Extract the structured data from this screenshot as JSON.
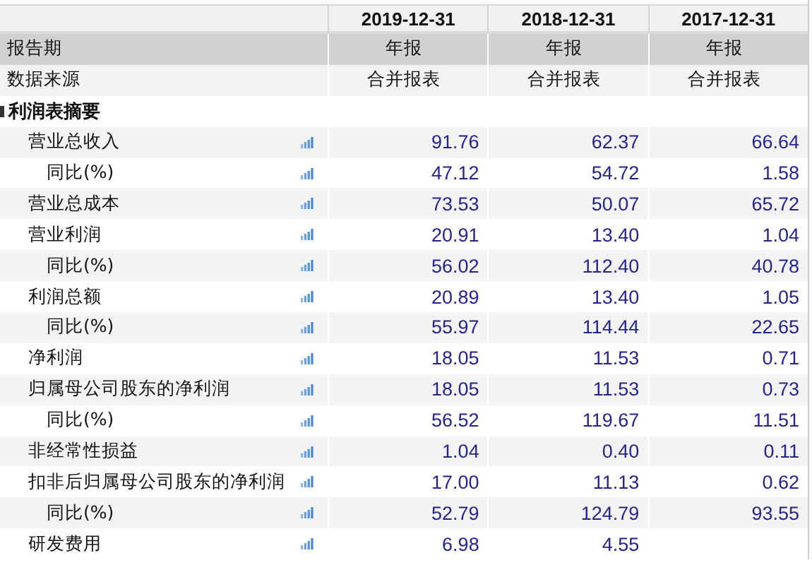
{
  "columns": [
    "2019-12-31",
    "2018-12-31",
    "2017-12-31"
  ],
  "meta_rows": [
    {
      "label": "报告期",
      "kind": "period",
      "values": [
        "年报",
        "年报",
        "年报"
      ]
    },
    {
      "label": "数据来源",
      "kind": "source",
      "values": [
        "合并报表",
        "合并报表",
        "合并报表"
      ]
    }
  ],
  "section": {
    "title": "利润表摘要",
    "expanded": true,
    "rows": [
      {
        "label": "营业总收入",
        "values": [
          "91.76",
          "62.37",
          "66.64"
        ],
        "children": [
          {
            "label": "同比(%)",
            "values": [
              "47.12",
              "54.72",
              "1.58"
            ]
          }
        ]
      },
      {
        "label": "营业总成本",
        "values": [
          "73.53",
          "50.07",
          "65.72"
        ]
      },
      {
        "label": "营业利润",
        "values": [
          "20.91",
          "13.40",
          "1.04"
        ],
        "children": [
          {
            "label": "同比(%)",
            "values": [
              "56.02",
              "112.40",
              "40.78"
            ]
          }
        ]
      },
      {
        "label": "利润总额",
        "values": [
          "20.89",
          "13.40",
          "1.05"
        ],
        "children": [
          {
            "label": "同比(%)",
            "values": [
              "55.97",
              "114.44",
              "22.65"
            ]
          }
        ]
      },
      {
        "label": "净利润",
        "values": [
          "18.05",
          "11.53",
          "0.71"
        ]
      },
      {
        "label": "归属母公司股东的净利润",
        "values": [
          "18.05",
          "11.53",
          "0.73"
        ],
        "children": [
          {
            "label": "同比(%)",
            "values": [
              "56.52",
              "119.67",
              "11.51"
            ]
          }
        ]
      },
      {
        "label": "非经常性损益",
        "values": [
          "1.04",
          "0.40",
          "0.11"
        ]
      },
      {
        "label": "扣非后归属母公司股东的净利润",
        "values": [
          "17.00",
          "11.13",
          "0.62"
        ],
        "children": [
          {
            "label": "同比(%)",
            "values": [
              "52.79",
              "124.79",
              "93.55"
            ]
          }
        ]
      },
      {
        "label": "研发费用",
        "values": [
          "6.98",
          "4.55"
        ]
      }
    ]
  }
}
